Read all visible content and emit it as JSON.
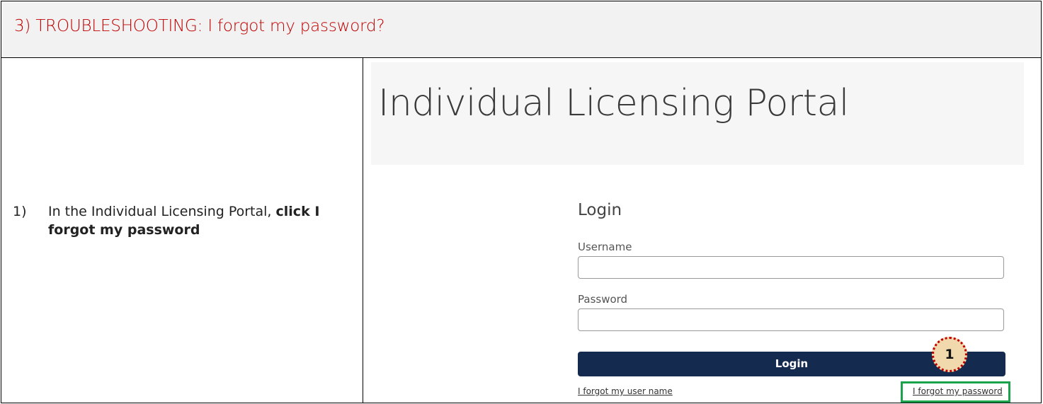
{
  "section": {
    "title": "3)  TROUBLESHOOTING: I forgot my password?"
  },
  "instruction": {
    "number": "1)",
    "text_before": "In the Individual Licensing Portal, ",
    "text_bold": "click I forgot my password"
  },
  "portal": {
    "title": "Individual Licensing Portal",
    "login_heading": "Login",
    "username_label": "Username",
    "username_value": "",
    "password_label": "Password",
    "password_value": "",
    "login_button": "Login",
    "forgot_username_link": "I forgot my user name",
    "forgot_password_link": "I forgot my password"
  },
  "callout": {
    "number": "1"
  },
  "colors": {
    "title_red": "#c00000",
    "login_button": "#142a4e",
    "highlight_green": "#1aa34a",
    "callout_fill": "#f2d9ad"
  }
}
